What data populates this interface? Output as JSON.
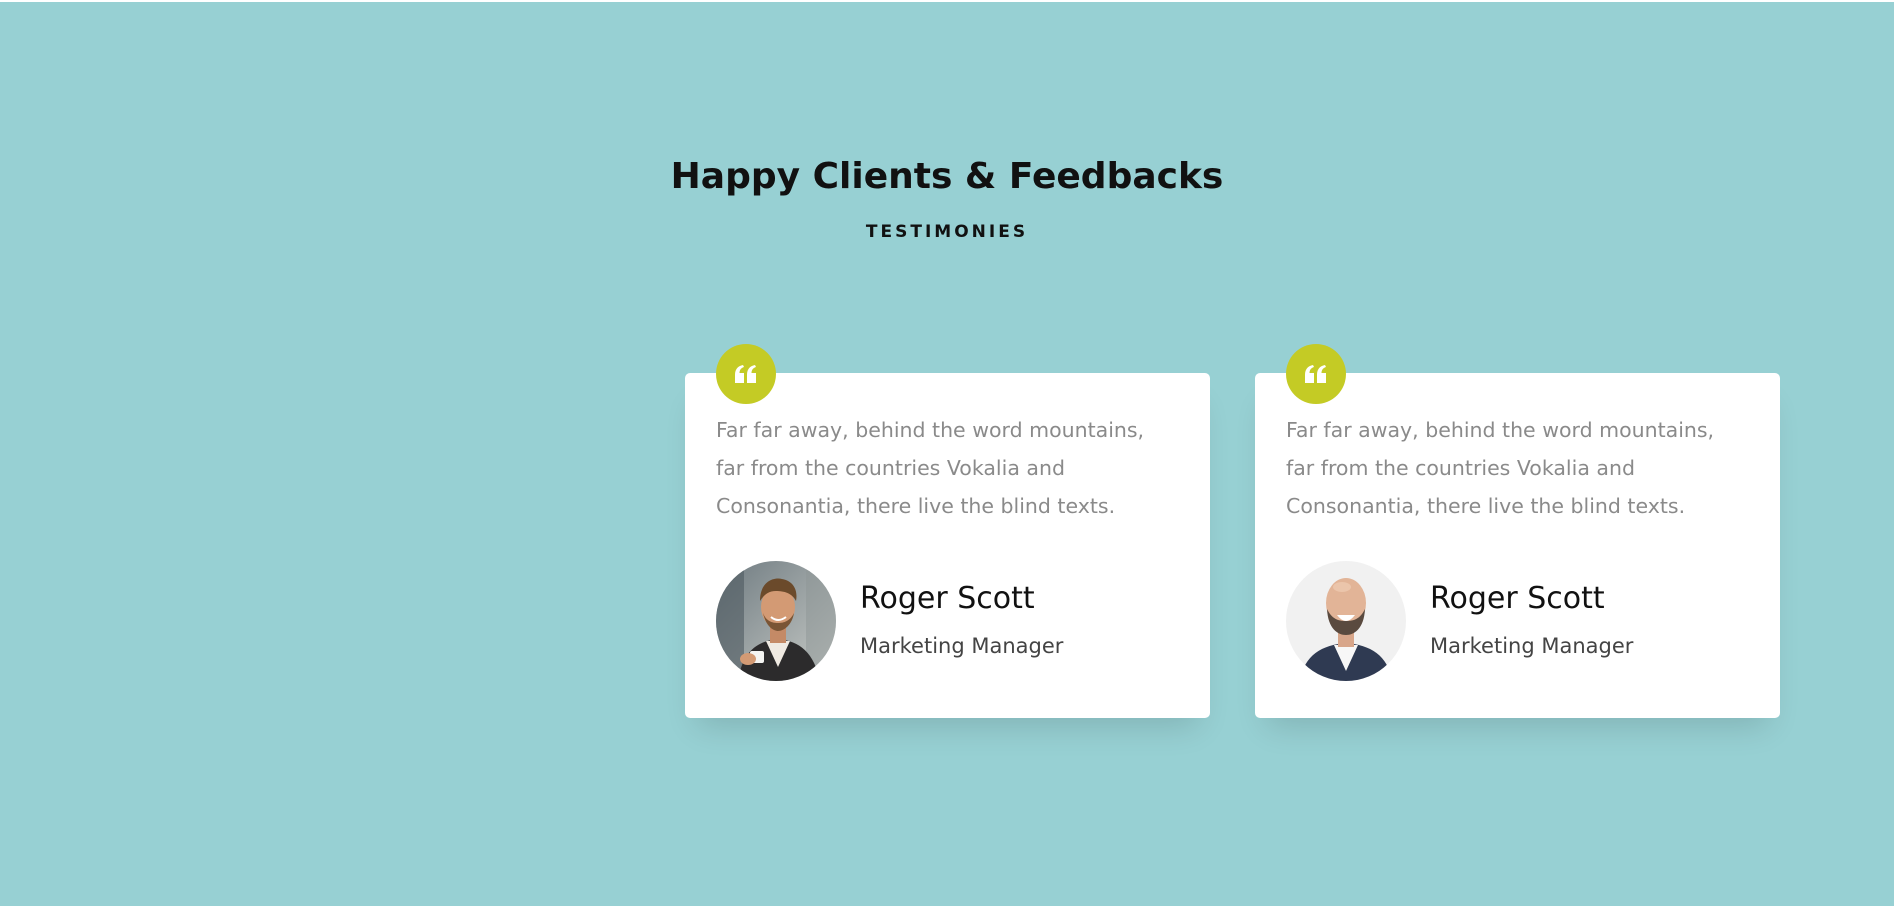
{
  "section": {
    "background_color": "#97d0d3",
    "title": "Happy Clients & Feedbacks",
    "subtitle": "TESTIMONIES"
  },
  "testimonials": [
    {
      "icon": "quote-left-icon",
      "text_lines": [
        "Far far away, behind the word mountains,",
        "far from the countries Vokalia and",
        "Consonantia, there live the blind texts."
      ],
      "name": "Roger Scott",
      "role": "Marketing Manager"
    },
    {
      "icon": "quote-left-icon",
      "text_lines": [
        "Far far away, behind the word mountains,",
        "far from the countries Vokalia and",
        "Consonantia, there live the blind texts."
      ],
      "name": "Roger Scott",
      "role": "Marketing Manager"
    }
  ],
  "colors": {
    "accent": "#c4cb25",
    "card_background": "#ffffff",
    "body_text": "#8a8a8a",
    "heading_text": "#111111"
  }
}
